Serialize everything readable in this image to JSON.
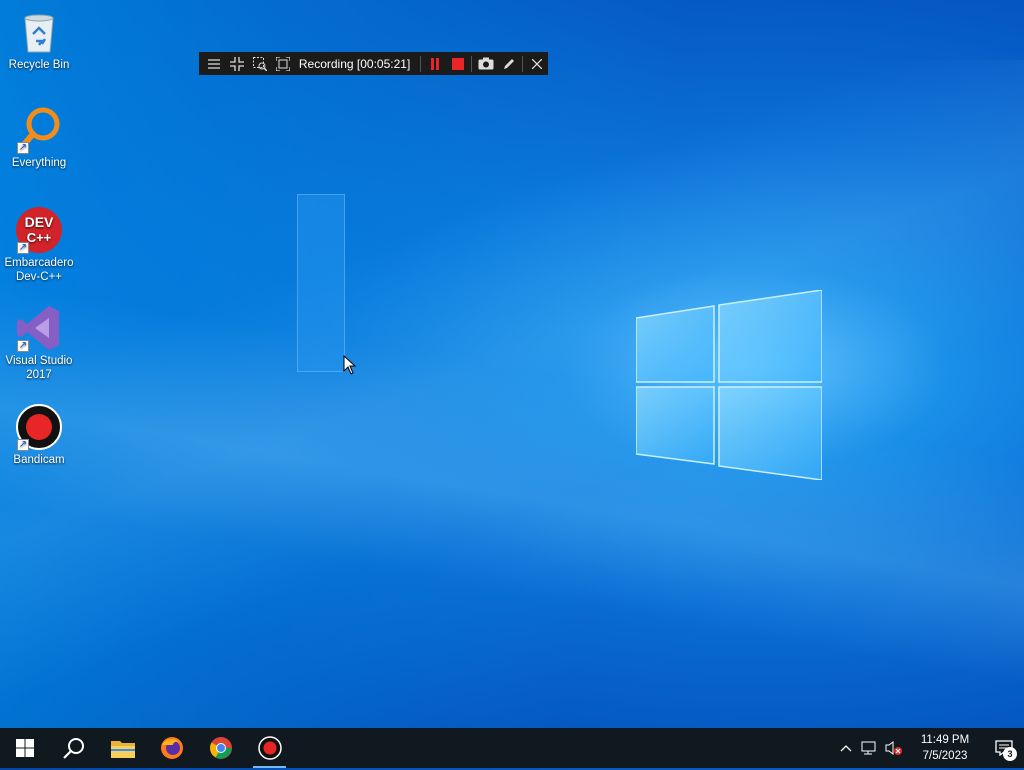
{
  "desktop": {
    "icons": [
      {
        "label": "Recycle Bin"
      },
      {
        "label": "Everything"
      },
      {
        "label": "Embarcadero Dev-C++"
      },
      {
        "label": "Visual Studio 2017"
      },
      {
        "label": "Bandicam"
      }
    ],
    "devcpp_badge_line1": "DEV",
    "devcpp_badge_line2": "C++"
  },
  "recorder": {
    "title": "Recording [00:05:21]",
    "buttons": [
      "menu",
      "shrink",
      "select-area",
      "fullscreen",
      "pause",
      "stop",
      "screenshot",
      "draw",
      "close"
    ]
  },
  "taskbar": {
    "apps": [
      "start",
      "search",
      "file-explorer",
      "firefox",
      "chrome",
      "bandicam"
    ],
    "active_app": "bandicam"
  },
  "tray": {
    "time": "11:49 PM",
    "date": "7/5/2023",
    "notification_count": "3"
  },
  "colors": {
    "taskbar": "#101820",
    "recorder_bar": "#1b1b1b",
    "record_red": "#e82626"
  }
}
